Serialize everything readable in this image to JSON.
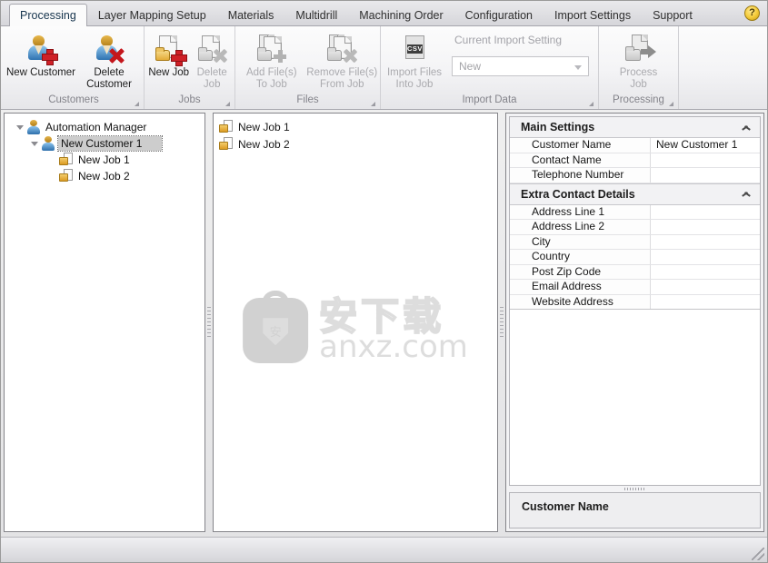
{
  "window": {
    "title": "Automation Manager"
  },
  "tabs": [
    {
      "label": "Processing",
      "active": true
    },
    {
      "label": "Layer Mapping Setup",
      "active": false
    },
    {
      "label": "Materials",
      "active": false
    },
    {
      "label": "Multidrill",
      "active": false
    },
    {
      "label": "Machining Order",
      "active": false
    },
    {
      "label": "Configuration",
      "active": false
    },
    {
      "label": "Import Settings",
      "active": false
    },
    {
      "label": "Support",
      "active": false
    }
  ],
  "help": {
    "icon": "help-icon",
    "glyph": "?"
  },
  "ribbon": {
    "groups": [
      {
        "title": "Customers",
        "buttons": [
          {
            "label": "New Customer",
            "icon": "new-customer-icon",
            "disabled": false
          },
          {
            "label": "Delete\nCustomer",
            "icon": "delete-customer-icon",
            "disabled": false
          }
        ]
      },
      {
        "title": "Jobs",
        "buttons": [
          {
            "label": "New Job",
            "icon": "new-job-icon",
            "disabled": false
          },
          {
            "label": "Delete\nJob",
            "icon": "delete-job-icon",
            "disabled": true
          }
        ]
      },
      {
        "title": "Files",
        "buttons": [
          {
            "label": "Add File(s)\nTo Job",
            "icon": "add-files-icon",
            "disabled": true
          },
          {
            "label": "Remove File(s)\nFrom Job",
            "icon": "remove-files-icon",
            "disabled": true
          }
        ]
      },
      {
        "title": "Import Data",
        "buttons": [
          {
            "label": "Import Files\nInto Job",
            "icon": "import-files-csv-icon",
            "disabled": true
          }
        ],
        "combo": {
          "caption": "Current Import Setting",
          "value": "New",
          "icon": "chevron-down-icon"
        }
      },
      {
        "title": "Processing",
        "buttons": [
          {
            "label": "Process\nJob",
            "icon": "process-job-icon",
            "disabled": true
          }
        ]
      }
    ]
  },
  "tree": {
    "nodes": [
      {
        "label": "Automation Manager",
        "icon": "person-icon",
        "depth": 0,
        "expanded": true,
        "selected": false
      },
      {
        "label": "New Customer 1",
        "icon": "person-icon",
        "depth": 1,
        "expanded": true,
        "selected": true
      },
      {
        "label": "New Job 1",
        "icon": "job-icon",
        "depth": 2,
        "expanded": false,
        "selected": false
      },
      {
        "label": "New Job 2",
        "icon": "job-icon",
        "depth": 2,
        "expanded": false,
        "selected": false
      }
    ]
  },
  "files": {
    "items": [
      {
        "label": "New Job 1",
        "icon": "job-icon"
      },
      {
        "label": "New Job 2",
        "icon": "job-icon"
      }
    ]
  },
  "watermark": {
    "badge_glyph": "安",
    "chinese": "安下载",
    "latin": "anxz.com"
  },
  "properties": {
    "categories": [
      {
        "title": "Main Settings",
        "collapse_icon": "chevron-up-icon",
        "rows": [
          {
            "name": "Customer Name",
            "value": "New Customer 1"
          },
          {
            "name": "Contact Name",
            "value": ""
          },
          {
            "name": "Telephone Number",
            "value": ""
          }
        ]
      },
      {
        "title": "Extra Contact Details",
        "collapse_icon": "chevron-up-icon",
        "rows": [
          {
            "name": "Address Line 1",
            "value": ""
          },
          {
            "name": "Address Line 2",
            "value": ""
          },
          {
            "name": "City",
            "value": ""
          },
          {
            "name": "Country",
            "value": ""
          },
          {
            "name": "Post Zip Code",
            "value": ""
          },
          {
            "name": "Email Address",
            "value": ""
          },
          {
            "name": "Website Address",
            "value": ""
          }
        ]
      }
    ],
    "description": {
      "title": "Customer Name"
    }
  },
  "statusbar": {
    "resizer_icon": "resize-grip-icon"
  },
  "colors": {
    "accent": "#2f73b0",
    "delete": "#c4161c",
    "add": "#cf2027",
    "folder": "#e2a92f",
    "help": "#f5cc3b"
  }
}
